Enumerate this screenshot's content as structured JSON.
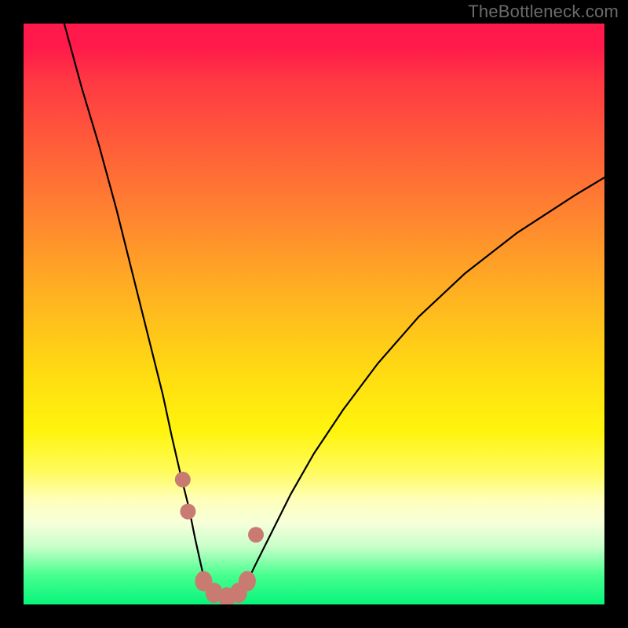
{
  "watermark": "TheBottleneck.com",
  "colors": {
    "frame": "#000000",
    "watermark_text": "#6b6b6b",
    "curve": "#000000",
    "marker": "#c97b72",
    "gradient_top": "#ff1a4b",
    "gradient_mid": "#fff40d",
    "gradient_bottom": "#08f57c"
  },
  "chart_data": {
    "type": "line",
    "title": "",
    "xlabel": "",
    "ylabel": "",
    "xlim": [
      0,
      100
    ],
    "ylim": [
      0,
      100
    ],
    "grid": false,
    "notes": "No numeric axes shown; values are normalized 0–100 to pixel space of the 740×740 plot area. Background heat gradient implies lower y = better (green).",
    "series": [
      {
        "name": "left-branch",
        "x": [
          7,
          10,
          13,
          16,
          18,
          20,
          22,
          24,
          25.5,
          27,
          28.5,
          29.5,
          30.5,
          31.3
        ],
        "y": [
          100,
          89,
          79,
          68,
          60,
          52,
          44,
          36,
          29,
          22.5,
          16.5,
          11.5,
          7,
          3.5
        ]
      },
      {
        "name": "valley-floor",
        "x": [
          31.3,
          32.5,
          34,
          35.5,
          37,
          38.3
        ],
        "y": [
          3.5,
          1.8,
          1.0,
          1.0,
          1.8,
          3.5
        ]
      },
      {
        "name": "right-branch",
        "x": [
          38.3,
          40,
          42.5,
          46,
          50,
          55,
          61,
          68,
          76,
          85,
          95,
          100
        ],
        "y": [
          3.5,
          7,
          12,
          19,
          26,
          33.5,
          41.5,
          49.5,
          57,
          64,
          70.5,
          73.5
        ]
      }
    ],
    "markers": [
      {
        "name": "pt-left-upper",
        "x": 27.4,
        "y": 21.5
      },
      {
        "name": "pt-left-mid",
        "x": 28.3,
        "y": 16.0
      },
      {
        "name": "pt-right-upper",
        "x": 40.0,
        "y": 12.0
      },
      {
        "name": "floor-blob-1",
        "x": 31.0,
        "y": 4.0
      },
      {
        "name": "floor-blob-2",
        "x": 32.8,
        "y": 2.0
      },
      {
        "name": "floor-blob-3",
        "x": 35.0,
        "y": 1.2
      },
      {
        "name": "floor-blob-4",
        "x": 37.0,
        "y": 2.0
      },
      {
        "name": "floor-blob-5",
        "x": 38.5,
        "y": 4.0
      }
    ]
  }
}
